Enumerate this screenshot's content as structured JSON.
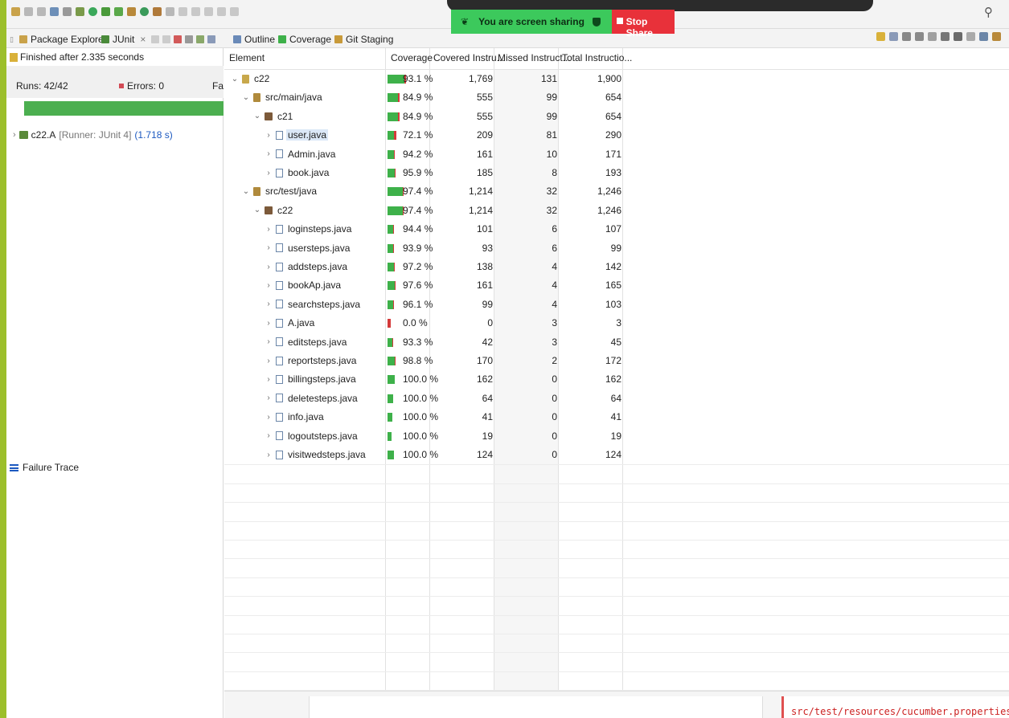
{
  "screen_share": {
    "banner_text": "You are screen sharing",
    "stop_label": "Stop Share"
  },
  "tabs": {
    "package_explorer": "Package Explorer",
    "junit": "JUnit",
    "outline": "Outline",
    "coverage": "Coverage",
    "git_staging": "Git Staging",
    "close_glyph": "×"
  },
  "junit": {
    "status": "Finished after 2.335 seconds",
    "runs": "Runs: 42/42",
    "errors": "Errors: 0",
    "failures": "Fa",
    "test_name": "c22.A",
    "test_runner": "[Runner: JUnit 4]",
    "test_time": "(1.718 s)",
    "progress_fraction": 1.0,
    "progress_color": "#4caf50",
    "failure_trace": "Failure Trace"
  },
  "coverage_table": {
    "headers": {
      "element": "Element",
      "coverage": "Coverage",
      "covered": "Covered Instru...",
      "missed": "Missed Instruct...",
      "total": "Total Instructio..."
    },
    "rows": [
      {
        "name": "c22",
        "level": 0,
        "kind": "project",
        "expanded": true,
        "coverage": "93.1 %",
        "covered": "1,769",
        "missed": "131",
        "total": "1,900"
      },
      {
        "name": "src/main/java",
        "level": 1,
        "kind": "source",
        "expanded": true,
        "coverage": "84.9 %",
        "covered": "555",
        "missed": "99",
        "total": "654"
      },
      {
        "name": "c21",
        "level": 2,
        "kind": "package",
        "expanded": true,
        "coverage": "84.9 %",
        "covered": "555",
        "missed": "99",
        "total": "654"
      },
      {
        "name": "user.java",
        "level": 3,
        "kind": "file",
        "expanded": false,
        "selected": true,
        "coverage": "72.1 %",
        "covered": "209",
        "missed": "81",
        "total": "290"
      },
      {
        "name": "Admin.java",
        "level": 3,
        "kind": "file",
        "expanded": false,
        "coverage": "94.2 %",
        "covered": "161",
        "missed": "10",
        "total": "171"
      },
      {
        "name": "book.java",
        "level": 3,
        "kind": "file",
        "expanded": false,
        "coverage": "95.9 %",
        "covered": "185",
        "missed": "8",
        "total": "193"
      },
      {
        "name": "src/test/java",
        "level": 1,
        "kind": "source",
        "expanded": true,
        "coverage": "97.4 %",
        "covered": "1,214",
        "missed": "32",
        "total": "1,246"
      },
      {
        "name": "c22",
        "level": 2,
        "kind": "package",
        "expanded": true,
        "coverage": "97.4 %",
        "covered": "1,214",
        "missed": "32",
        "total": "1,246"
      },
      {
        "name": "loginsteps.java",
        "level": 3,
        "kind": "file",
        "expanded": false,
        "coverage": "94.4 %",
        "covered": "101",
        "missed": "6",
        "total": "107"
      },
      {
        "name": "usersteps.java",
        "level": 3,
        "kind": "file",
        "expanded": false,
        "coverage": "93.9 %",
        "covered": "93",
        "missed": "6",
        "total": "99"
      },
      {
        "name": "addsteps.java",
        "level": 3,
        "kind": "file",
        "expanded": false,
        "coverage": "97.2 %",
        "covered": "138",
        "missed": "4",
        "total": "142"
      },
      {
        "name": "bookAp.java",
        "level": 3,
        "kind": "file",
        "expanded": false,
        "coverage": "97.6 %",
        "covered": "161",
        "missed": "4",
        "total": "165"
      },
      {
        "name": "searchsteps.java",
        "level": 3,
        "kind": "file",
        "expanded": false,
        "coverage": "96.1 %",
        "covered": "99",
        "missed": "4",
        "total": "103"
      },
      {
        "name": "A.java",
        "level": 3,
        "kind": "file",
        "expanded": false,
        "coverage": "0.0 %",
        "covered": "0",
        "missed": "3",
        "total": "3"
      },
      {
        "name": "editsteps.java",
        "level": 3,
        "kind": "file",
        "expanded": false,
        "coverage": "93.3 %",
        "covered": "42",
        "missed": "3",
        "total": "45"
      },
      {
        "name": "reportsteps.java",
        "level": 3,
        "kind": "file",
        "expanded": false,
        "coverage": "98.8 %",
        "covered": "170",
        "missed": "2",
        "total": "172"
      },
      {
        "name": "billingsteps.java",
        "level": 3,
        "kind": "file",
        "expanded": false,
        "coverage": "100.0 %",
        "covered": "162",
        "missed": "0",
        "total": "162"
      },
      {
        "name": "deletesteps.java",
        "level": 3,
        "kind": "file",
        "expanded": false,
        "coverage": "100.0 %",
        "covered": "64",
        "missed": "0",
        "total": "64"
      },
      {
        "name": "info.java",
        "level": 3,
        "kind": "file",
        "expanded": false,
        "coverage": "100.0 %",
        "covered": "41",
        "missed": "0",
        "total": "41"
      },
      {
        "name": "logoutsteps.java",
        "level": 3,
        "kind": "file",
        "expanded": false,
        "coverage": "100.0 %",
        "covered": "19",
        "missed": "0",
        "total": "19"
      },
      {
        "name": "visitwedsteps.java",
        "level": 3,
        "kind": "file",
        "expanded": false,
        "coverage": "100.0 %",
        "covered": "124",
        "missed": "0",
        "total": "124"
      }
    ]
  },
  "console": {
    "text": "src/test/resources/cucumber.properties:"
  },
  "colors": {
    "accent": "#9cbf2b",
    "covered": "#3eb14a",
    "missed": "#d43a3a",
    "selection": "#dbe8f7",
    "banner": "#3cc95c",
    "stop": "#e8313a"
  }
}
